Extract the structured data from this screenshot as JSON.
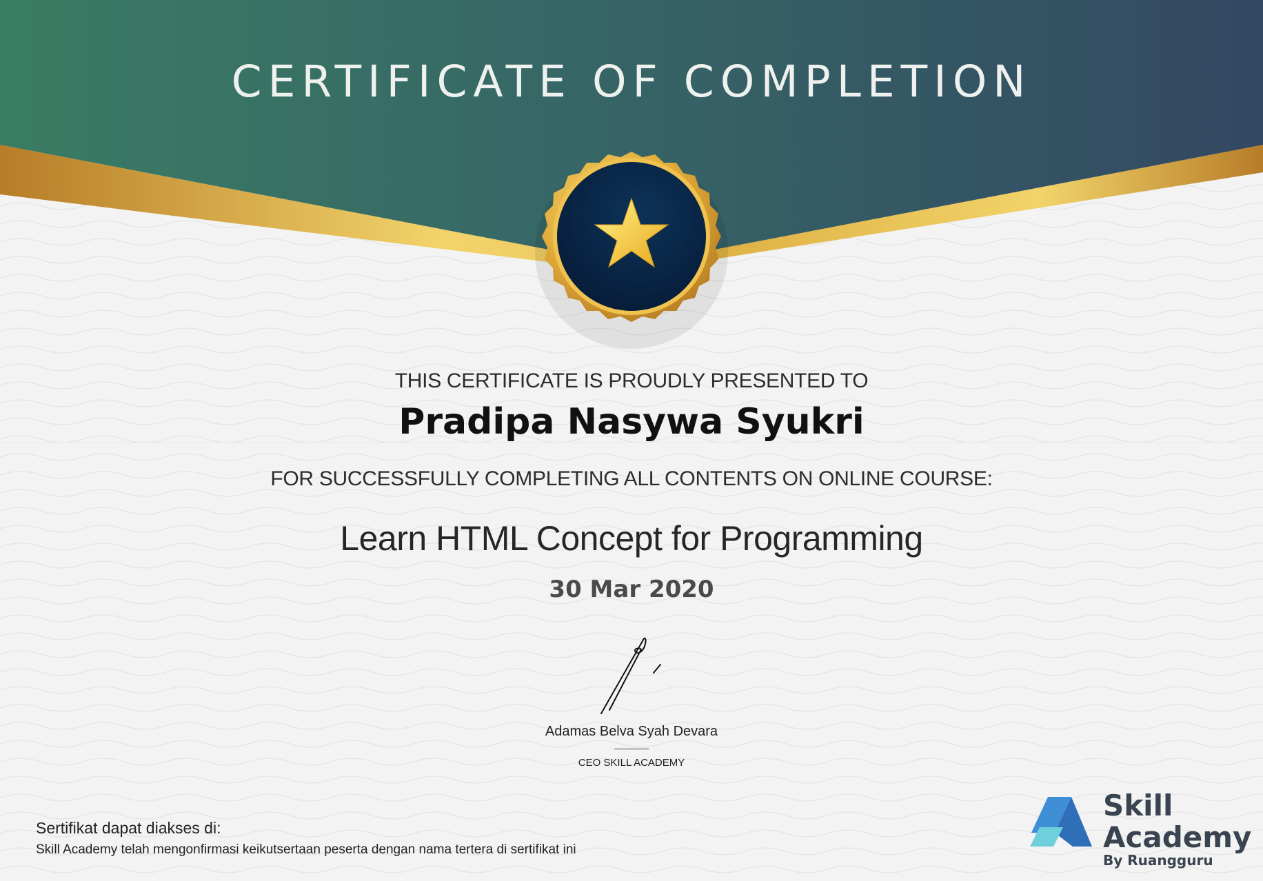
{
  "header": {
    "title": "CERTIFICATE OF COMPLETION"
  },
  "certificate": {
    "presented_to_label": "THIS CERTIFICATE IS PROUDLY PRESENTED TO",
    "recipient_name": "Pradipa Nasywa Syukri",
    "completion_label": "FOR SUCCESSFULLY COMPLETING ALL CONTENTS ON ONLINE COURSE:",
    "course_title": "Learn HTML Concept for Programming",
    "date": "30 Mar 2020"
  },
  "signatory": {
    "name": "Adamas Belva Syah Devara",
    "role": "CEO SKILL ACADEMY"
  },
  "footer": {
    "access_label": "Sertifikat dapat diakses di:",
    "note": "Skill Academy telah mengonfirmasi keikutsertaan peserta dengan nama tertera di sertifikat ini"
  },
  "logo": {
    "line1": "Skill",
    "line2": "Academy",
    "tagline": "By Ruangguru"
  },
  "colors": {
    "header_green": "#3a7a64",
    "header_navy": "#34475f",
    "gold": "#e7b93e",
    "medal_navy": "#0b2444",
    "logo_blue": "#2f7fc9",
    "logo_teal": "#5cc7d6"
  }
}
